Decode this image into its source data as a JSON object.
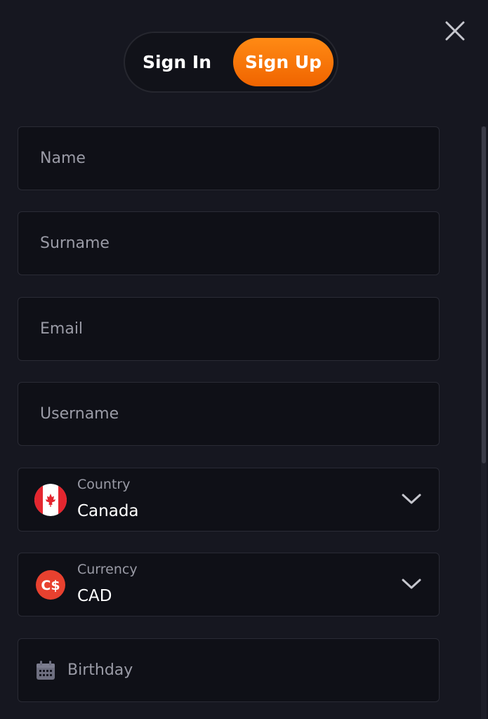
{
  "auth_tabs": {
    "sign_in": "Sign In",
    "sign_up": "Sign Up",
    "active": "sign_up"
  },
  "form": {
    "name": {
      "placeholder": "Name",
      "value": ""
    },
    "surname": {
      "placeholder": "Surname",
      "value": ""
    },
    "email": {
      "placeholder": "Email",
      "value": ""
    },
    "username": {
      "placeholder": "Username",
      "value": ""
    },
    "country": {
      "label": "Country",
      "value": "Canada",
      "icon": "canada-flag-icon"
    },
    "currency": {
      "label": "Currency",
      "value": "CAD",
      "icon": "cad-currency-icon",
      "icon_text": "C$"
    },
    "birthday": {
      "placeholder": "Birthday",
      "value": "",
      "icon": "calendar-icon"
    }
  },
  "colors": {
    "background": "#161720",
    "field_bg": "#0f1017",
    "accent_start": "#ff8a14",
    "accent_end": "#f06400",
    "placeholder": "#9a9ba6",
    "flag_red": "#e4262f",
    "currency_red": "#e8412f"
  }
}
